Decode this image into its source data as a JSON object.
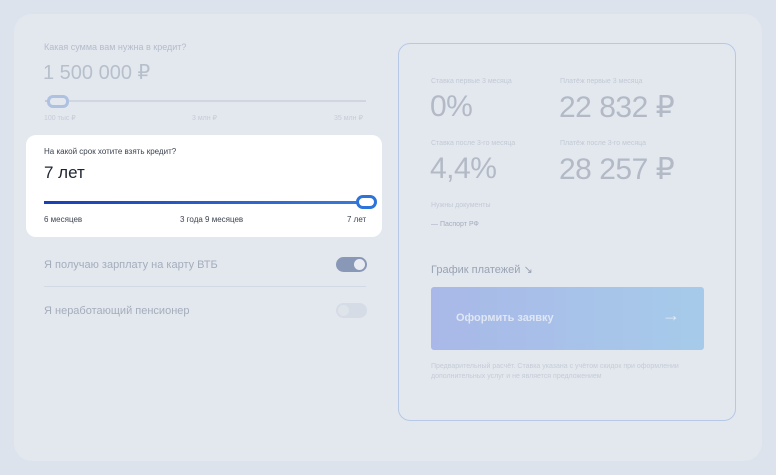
{
  "loan_amount": {
    "label": "Какая сумма вам нужна в кредит?",
    "value": "1 500 000 ₽",
    "min_label": "100 тыс ₽",
    "mid_label": "3 млн ₽",
    "max_label": "35 млн ₽",
    "slider_fraction": 0.04
  },
  "term": {
    "label": "На какой срок хотите взять кредит?",
    "value": "7 лет",
    "min_label": "6 месяцев",
    "mid_label": "3 года 9 месяцев",
    "max_label": "7 лет",
    "slider_fraction": 1.0
  },
  "options": [
    {
      "label": "Я получаю зарплату на карту ВТБ",
      "enabled": true
    },
    {
      "label": "Я неработающий пенсионер",
      "enabled": false
    }
  ],
  "results": {
    "rate_first_label": "Ставка первые 3 месяца",
    "rate_first_value": "0%",
    "payment_first_label": "Платёж первые 3 месяца",
    "payment_first_value": "22 832 ₽",
    "rate_after_label": "Ставка после 3-го месяца",
    "rate_after_value": "4,4%",
    "payment_after_label": "Платёж после 3-го месяца",
    "payment_after_value": "28 257 ₽",
    "docs_label": "Нужны документы",
    "docs_item": "— Паспорт РФ",
    "schedule_link": "График платежей ↘",
    "apply_label": "Оформить заявку",
    "apply_arrow": "→",
    "disclaimer": "Предварительный расчёт. Ставка указана с учётом скидок при оформлении дополнительных услуг и не является предложением"
  },
  "colors": {
    "accent": "#2d73d9",
    "track_start": "#1a3fb5",
    "toggle_on": "#8a98b8",
    "toggle_off": "#d6dce5"
  }
}
